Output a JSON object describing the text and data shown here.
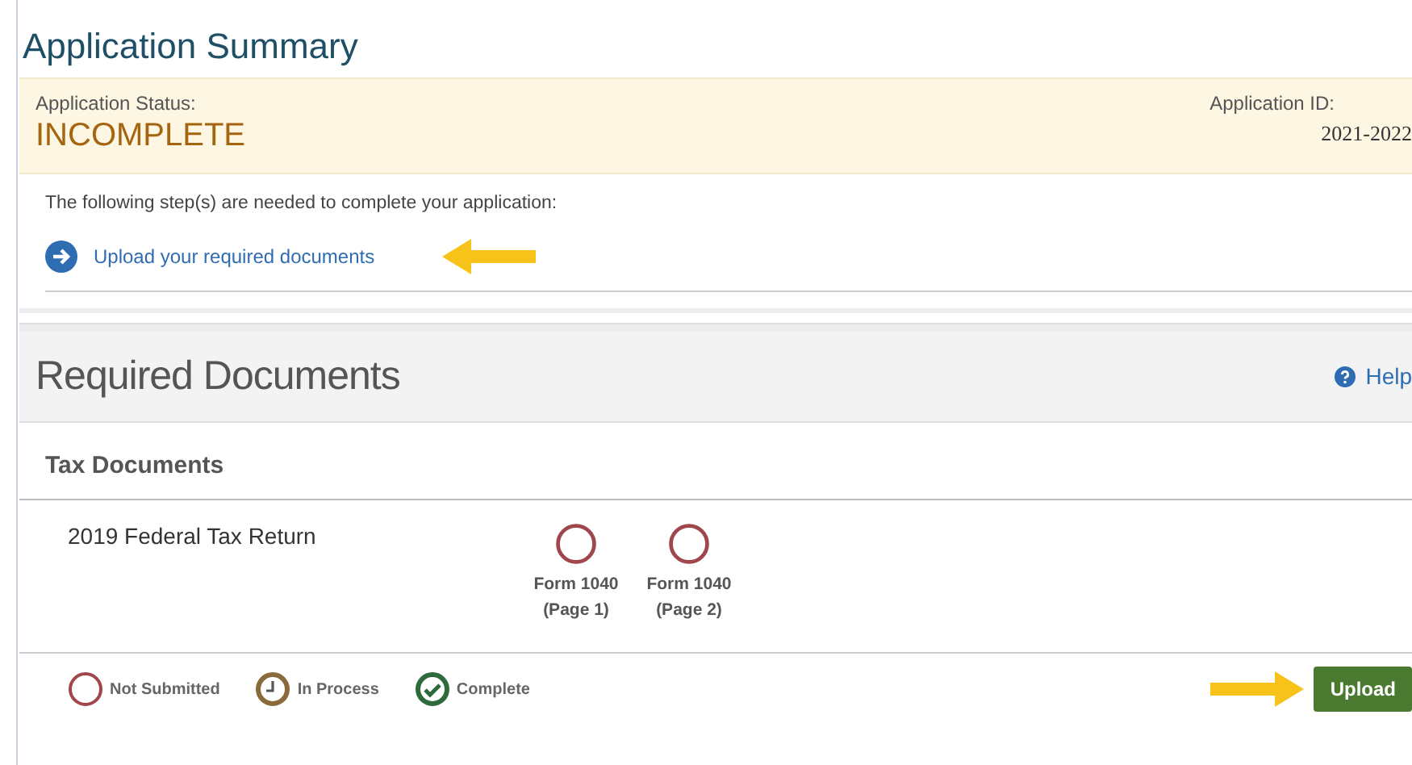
{
  "title": "Application Summary",
  "status": {
    "label": "Application Status:",
    "value": "INCOMPLETE",
    "id_label": "Application ID:",
    "id_value": "2021-2022"
  },
  "steps": {
    "intro": "The following step(s) are needed to complete your application:",
    "items": [
      {
        "label": "Upload your required documents"
      }
    ]
  },
  "required_documents": {
    "title": "Required Documents",
    "help": "Help",
    "section": "Tax Documents",
    "rows": [
      {
        "name": "2019 Federal Tax Return",
        "forms": [
          {
            "line1": "Form 1040",
            "line2": "(Page 1)",
            "kind": "not_submitted"
          },
          {
            "line1": "Form 1040",
            "line2": "(Page 2)",
            "kind": "not_submitted"
          }
        ]
      }
    ],
    "legend": [
      {
        "kind": "not_submitted",
        "label": "Not Submitted"
      },
      {
        "kind": "in_process",
        "label": "In Process"
      },
      {
        "kind": "complete",
        "label": "Complete"
      }
    ],
    "button": "Upload"
  }
}
